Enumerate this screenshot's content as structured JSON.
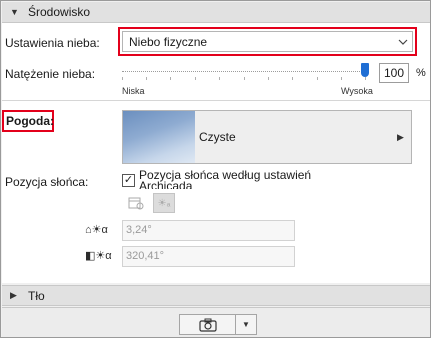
{
  "environment_section": {
    "title": "Środowisko"
  },
  "sky": {
    "settings_label": "Ustawienia nieba:",
    "settings_value": "Niebo fizyczne",
    "intensity_label": "Natężenie nieba:",
    "intensity_value": "100",
    "intensity_unit": "%",
    "intensity_level": 1.0,
    "slider_min_label": "Niska",
    "slider_max_label": "Wysoka"
  },
  "weather": {
    "label": "Pogoda:",
    "value": "Czyste"
  },
  "sun": {
    "label": "Pozycja słońca:",
    "checkbox_label_line1": "Pozycja słońca według ustawień",
    "checkbox_label_line2": "Archicada",
    "checked": true,
    "altitude_value": "3,24°",
    "azimuth_value": "320,41°"
  },
  "background_section": {
    "title": "Tło"
  },
  "accent_color": "#e3001b",
  "thumb_color": "#1f6ed4"
}
